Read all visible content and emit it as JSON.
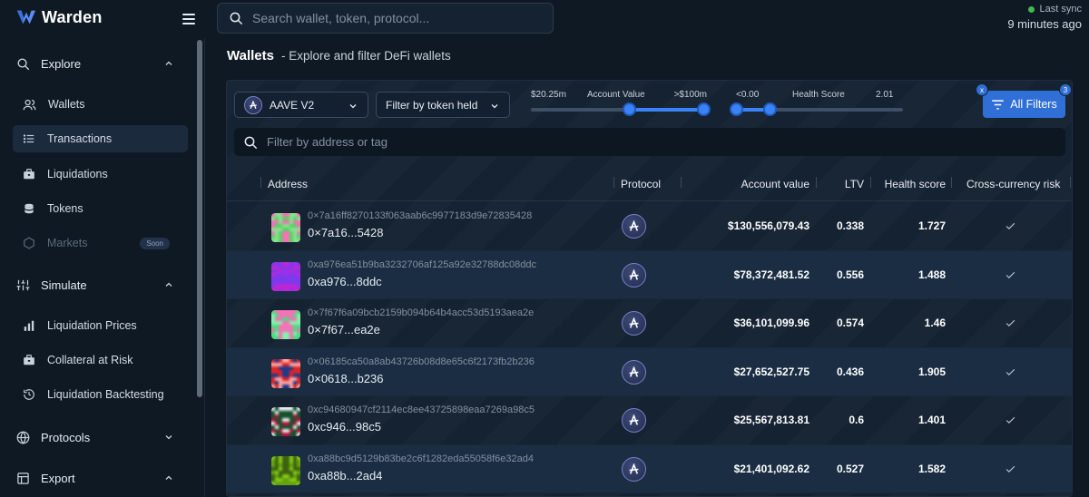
{
  "app": {
    "name": "Warden"
  },
  "search": {
    "placeholder": "Search wallet, token, protocol..."
  },
  "sync": {
    "label": "Last sync",
    "time": "9 minutes ago",
    "status_color": "#3fb950"
  },
  "sidebar": {
    "explore": {
      "label": "Explore",
      "items": [
        {
          "label": "Wallets",
          "icon": "users-icon"
        },
        {
          "label": "Transactions",
          "icon": "list-icon",
          "active": true
        },
        {
          "label": "Liquidations",
          "icon": "briefcase-icon"
        },
        {
          "label": "Tokens",
          "icon": "coins-icon"
        },
        {
          "label": "Markets",
          "icon": "hexagon-icon",
          "disabled": true,
          "badge": "Soon"
        }
      ]
    },
    "simulate": {
      "label": "Simulate",
      "items": [
        {
          "label": "Liquidation Prices",
          "icon": "bar-chart-icon"
        },
        {
          "label": "Collateral at Risk",
          "icon": "briefcase-icon"
        },
        {
          "label": "Liquidation Backtesting",
          "icon": "history-icon"
        }
      ]
    },
    "protocols": {
      "label": "Protocols"
    },
    "export": {
      "label": "Export"
    }
  },
  "page": {
    "title": "Wallets",
    "subtitle": "- Explore and filter DeFi wallets"
  },
  "filters": {
    "protocol_select": "AAVE V2",
    "token_select": "Filter by token held",
    "account_value": {
      "label": "Account Value",
      "min": "$20.25m",
      "max": ">$100m",
      "low_frac": 0.57,
      "high_frac": 1.0
    },
    "health_score": {
      "label": "Health Score",
      "min": "<0.00",
      "max": "2.01",
      "low_frac": 0.0,
      "high_frac": 0.2
    },
    "all_filters": "All Filters",
    "badge_clear": "x",
    "badge_count": "3",
    "address_placeholder": "Filter by address or tag"
  },
  "table": {
    "columns": [
      "Address",
      "Protocol",
      "Account value",
      "LTV",
      "Health score",
      "Cross-currency risk"
    ],
    "rows": [
      {
        "address": "0×7a16ff8270133f063aab6c9977183d9e72835428",
        "short": "0×7a16...5428",
        "protocol": "AAVE V2",
        "value": "$130,556,079.43",
        "ltv": "0.338",
        "health": "1.727",
        "avatar": [
          "#56d364",
          "#8ae08f",
          "#f472b6"
        ]
      },
      {
        "address": "0xa976ea51b9ba3232706af125a92e32788dc08ddc",
        "short": "0xa976...8ddc",
        "protocol": "AAVE V2",
        "value": "$78,372,481.52",
        "ltv": "0.556",
        "health": "1.488",
        "avatar": [
          "#9333ea",
          "#c026d3",
          "#7c3aed"
        ]
      },
      {
        "address": "0×7f67f6a09bcb2159b094b64b4acc53d5193aea2e",
        "short": "0×7f67...ea2e",
        "protocol": "AAVE V2",
        "value": "$36,101,099.96",
        "ltv": "0.574",
        "health": "1.46",
        "avatar": [
          "#86efac",
          "#f472b6",
          "#4ade80"
        ]
      },
      {
        "address": "0×06185ca50a8ab43726b08d8e65c6f2173fb2b236",
        "short": "0×0618...b236",
        "protocol": "AAVE V2",
        "value": "$27,652,527.75",
        "ltv": "0.436",
        "health": "1.905",
        "avatar": [
          "#1e3a8a",
          "#dc2626",
          "#fca5a5"
        ]
      },
      {
        "address": "0xc94680947cf2114ec8ee43725898eaa7269a98c5",
        "short": "0xc946...98c5",
        "protocol": "AAVE V2",
        "value": "$25,567,813.81",
        "ltv": "0.6",
        "health": "1.401",
        "avatar": [
          "#14532d",
          "#be123c",
          "#e5e7eb"
        ]
      },
      {
        "address": "0xa88bc9d5129b83be2c6f1282eda55058f6e32ad4",
        "short": "0xa88b...2ad4",
        "protocol": "AAVE V2",
        "value": "$21,401,092.62",
        "ltv": "0.527",
        "health": "1.582",
        "avatar": [
          "#65a30d",
          "#84cc16",
          "#3f6212"
        ]
      }
    ]
  },
  "colors": {
    "accent": "#3b82f6",
    "button": "#2f6fd6",
    "background": "#0f1923"
  }
}
